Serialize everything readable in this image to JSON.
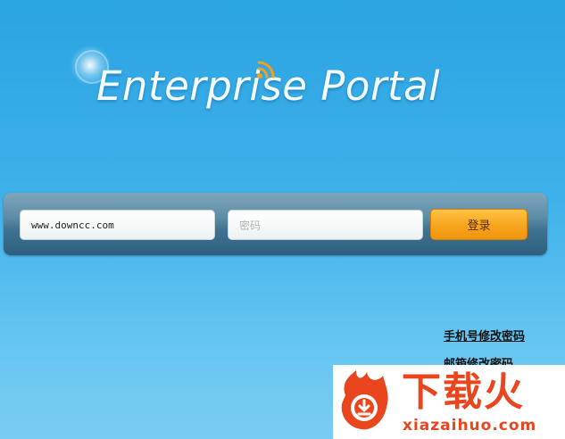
{
  "header": {
    "title": "Enterprise Portal"
  },
  "login": {
    "username_value": "www.downcc.com",
    "password_placeholder": "密码",
    "submit_label": "登录"
  },
  "links": {
    "phone_reset": "手机号修改密码",
    "email_reset": "邮箱修改密码"
  },
  "watermark": {
    "text_cn": "下载火",
    "text_en": "xiazaihuo.com"
  },
  "colors": {
    "background": "#3fb1ea",
    "button": "#f7a51e",
    "watermark": "#e9461e"
  },
  "icons": {
    "signal": "wifi-signal-icon",
    "logo": "flame-download-logo"
  }
}
